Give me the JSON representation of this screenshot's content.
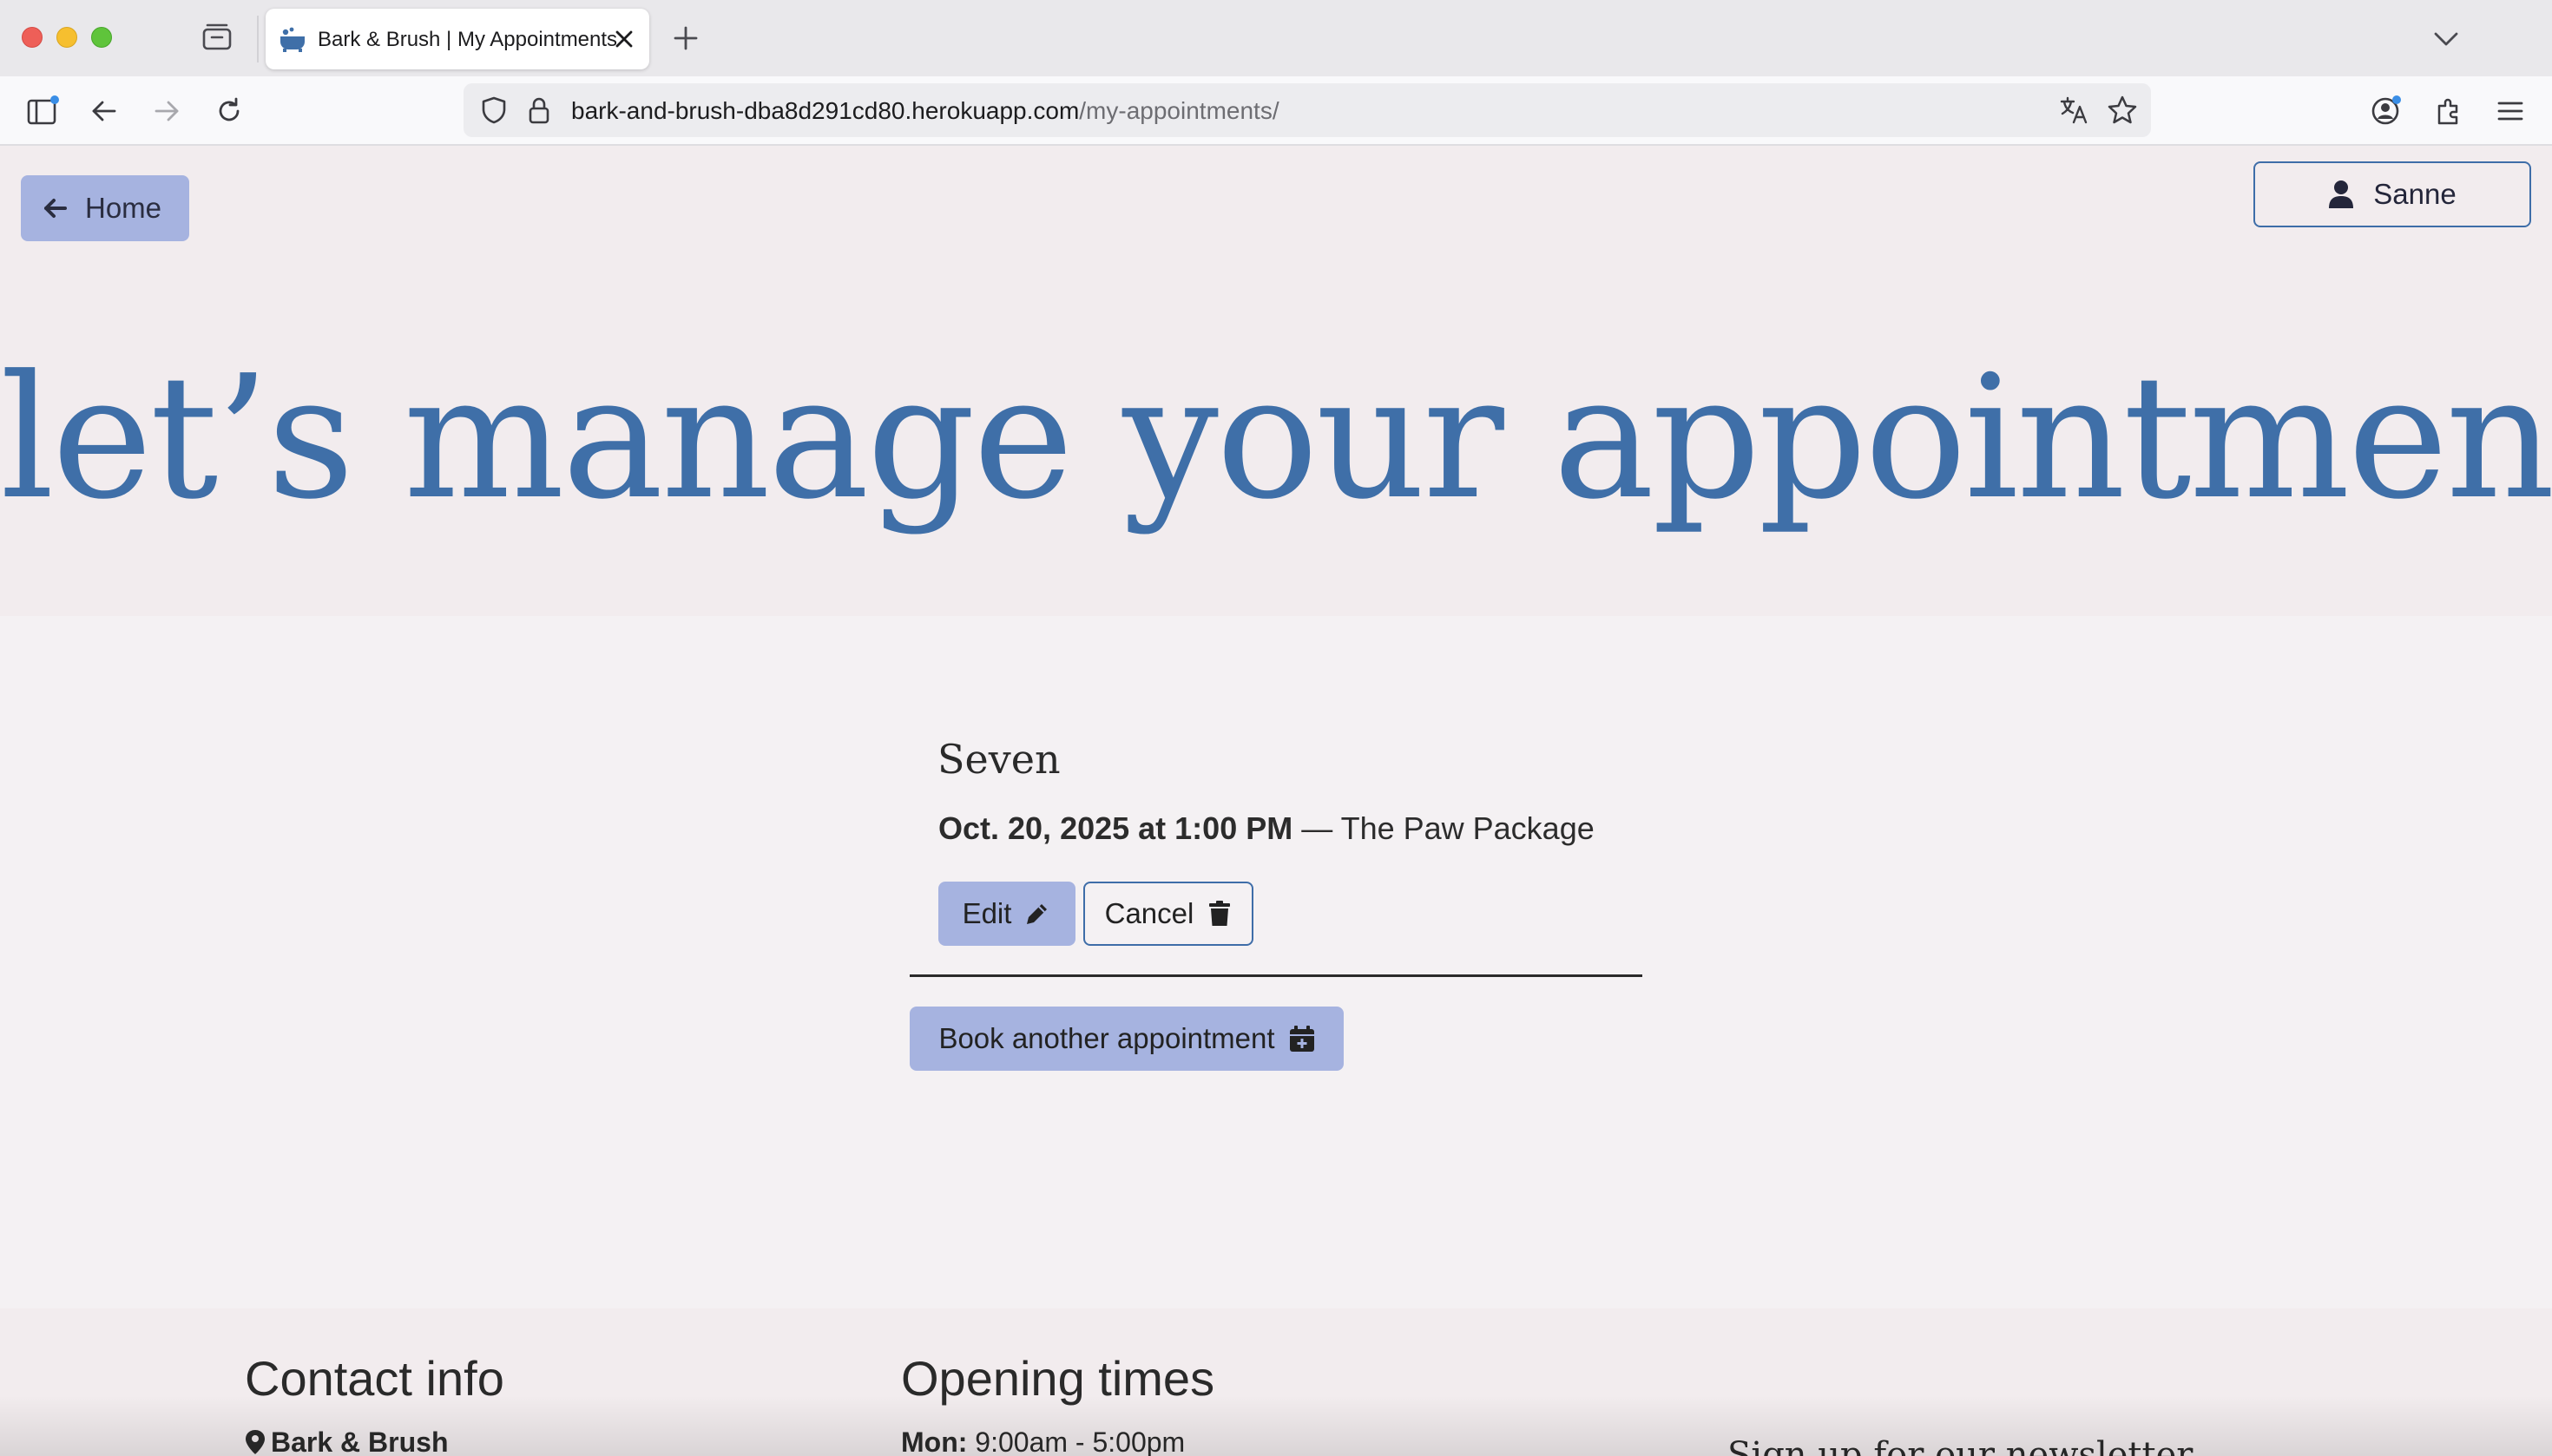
{
  "browser": {
    "tab_title": "Bark & Brush | My Appointments",
    "url_host": "bark-and-brush-dba8d291cd80.herokuapp.com",
    "url_path": "/my-appointments/",
    "icons": [
      "sidebar-icon",
      "back-arrow-icon",
      "forward-arrow-icon",
      "reload-icon",
      "shield-icon",
      "lock-icon",
      "translate-icon",
      "star-icon",
      "account-icon",
      "extensions-icon",
      "menu-icon"
    ]
  },
  "header": {
    "home_label": "Home",
    "user_label": "Sanne"
  },
  "hero": {
    "title": "let’s manage your appointments"
  },
  "appointment": {
    "pet_name": "Seven",
    "datetime": "Oct. 20, 2025 at 1:00 PM",
    "service": " — The Paw Package",
    "edit_label": "Edit",
    "cancel_label": "Cancel"
  },
  "book_label": "Book another appointment",
  "footer": {
    "contact_heading": "Contact info",
    "business_name": "Bark & Brush",
    "hours_heading": "Opening times",
    "mon_label": "Mon:",
    "mon_hours": " 9:00am - 5:00pm",
    "newsletter_text": "Sign up for our newsletter"
  },
  "colors": {
    "accent_blue": "#3f6fa8",
    "button_lilac": "#a6b3e0",
    "hero_bg": "#f2ecee",
    "page_bg": "#f4f1f3"
  }
}
